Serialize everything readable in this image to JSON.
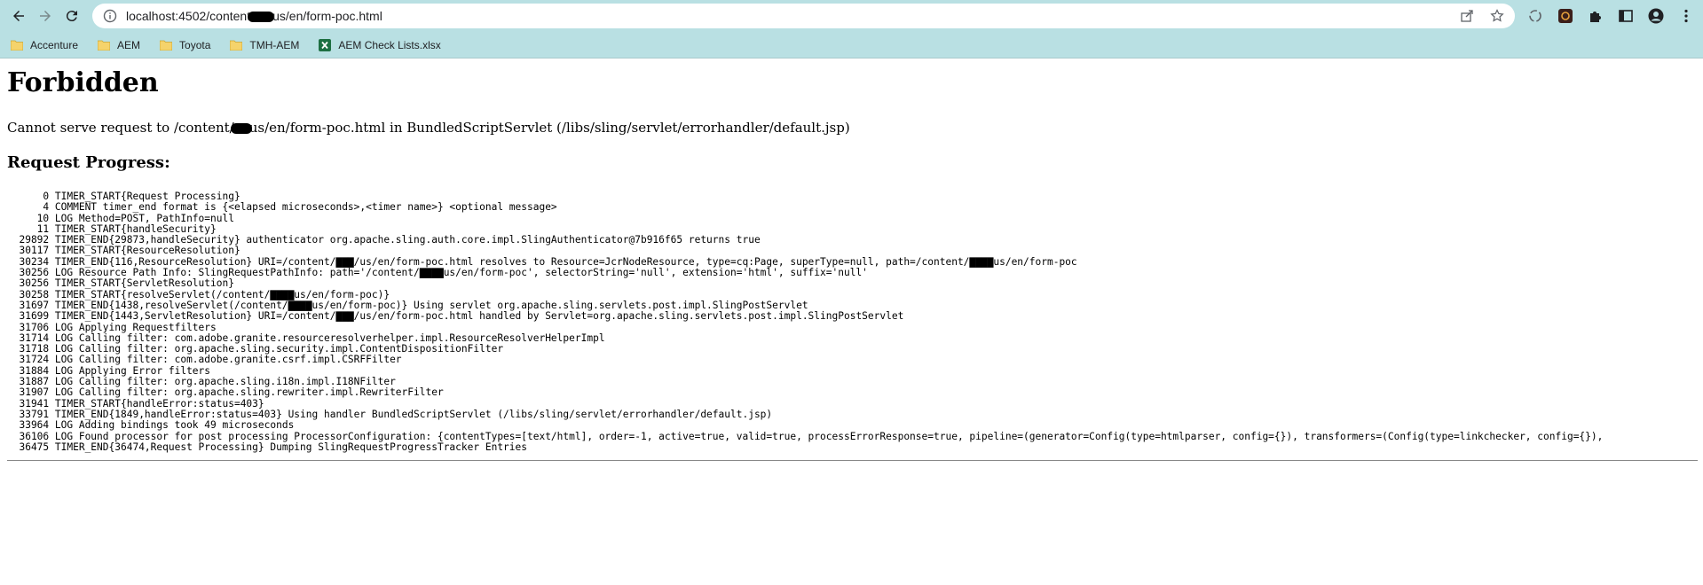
{
  "browser": {
    "url_prefix": "localhost:4502/content",
    "url_suffix": "us/en/form-poc.html",
    "bookmarks": [
      {
        "label": "Accenture",
        "icon": "folder-icon"
      },
      {
        "label": "AEM",
        "icon": "folder-icon"
      },
      {
        "label": "Toyota",
        "icon": "folder-icon"
      },
      {
        "label": "TMH-AEM",
        "icon": "folder-icon"
      },
      {
        "label": "AEM Check Lists.xlsx",
        "icon": "excel-icon"
      }
    ],
    "colors": {
      "chrome_bg": "#b9e0e3",
      "excel_green": "#1d6f42",
      "folder_yellow": "#f5d36b"
    }
  },
  "page": {
    "title": "Forbidden",
    "message_prefix": "Cannot serve request to /content/",
    "message_suffix": "us/en/form-poc.html in BundledScriptServlet (/libs/sling/servlet/errorhandler/default.jsp)",
    "progress_heading": "Request Progress:",
    "progress_lines": [
      [
        "      0",
        " TIMER_START{Request Processing}"
      ],
      [
        "      4",
        " COMMENT timer_end format is {<elapsed microseconds>,<timer name>} <optional message>"
      ],
      [
        "     10",
        " LOG Method=POST, PathInfo=null"
      ],
      [
        "     11",
        " TIMER_START{handleSecurity}"
      ],
      [
        "  29892",
        " TIMER_END{29873,handleSecurity} authenticator org.apache.sling.auth.core.impl.SlingAuthenticator@7b916f65 returns true"
      ],
      [
        "  30117",
        " TIMER_START{ResourceResolution}"
      ],
      [
        "  30234",
        " TIMER_END{116,ResourceResolution} URI=/content/▇▇▇/us/en/form-poc.html resolves to Resource=JcrNodeResource, type=cq:Page, superType=null, path=/content/▇▇▇▇us/en/form-poc"
      ],
      [
        "  30256",
        " LOG Resource Path Info: SlingRequestPathInfo: path='/content/▇▇▇▇us/en/form-poc', selectorString='null', extension='html', suffix='null'"
      ],
      [
        "  30256",
        " TIMER_START{ServletResolution}"
      ],
      [
        "  30258",
        " TIMER_START{resolveServlet(/content/▇▇▇▇us/en/form-poc)}"
      ],
      [
        "  31697",
        " TIMER_END{1438,resolveServlet(/content/▇▇▇▇us/en/form-poc)} Using servlet org.apache.sling.servlets.post.impl.SlingPostServlet"
      ],
      [
        "  31699",
        " TIMER_END{1443,ServletResolution} URI=/content/▇▇▇/us/en/form-poc.html handled by Servlet=org.apache.sling.servlets.post.impl.SlingPostServlet"
      ],
      [
        "  31706",
        " LOG Applying Requestfilters"
      ],
      [
        "  31714",
        " LOG Calling filter: com.adobe.granite.resourceresolverhelper.impl.ResourceResolverHelperImpl"
      ],
      [
        "  31718",
        " LOG Calling filter: org.apache.sling.security.impl.ContentDispositionFilter"
      ],
      [
        "  31724",
        " LOG Calling filter: com.adobe.granite.csrf.impl.CSRFFilter"
      ],
      [
        "  31884",
        " LOG Applying Error filters"
      ],
      [
        "  31887",
        " LOG Calling filter: org.apache.sling.i18n.impl.I18NFilter"
      ],
      [
        "  31907",
        " LOG Calling filter: org.apache.sling.rewriter.impl.RewriterFilter"
      ],
      [
        "  31941",
        " TIMER_START{handleError:status=403}"
      ],
      [
        "  33791",
        " TIMER_END{1849,handleError:status=403} Using handler BundledScriptServlet (/libs/sling/servlet/errorhandler/default.jsp)"
      ],
      [
        "  33964",
        " LOG Adding bindings took 49 microseconds"
      ],
      [
        "  36106",
        " LOG Found processor for post processing ProcessorConfiguration: {contentTypes=[text/html], order=-1, active=true, valid=true, processErrorResponse=true, pipeline=(generator=Config(type=htmlparser, config={}), transformers=(Config(type=linkchecker, config={}),"
      ],
      [
        "  36475",
        " TIMER_END{36474,Request Processing} Dumping SlingRequestProgressTracker Entries"
      ]
    ]
  }
}
